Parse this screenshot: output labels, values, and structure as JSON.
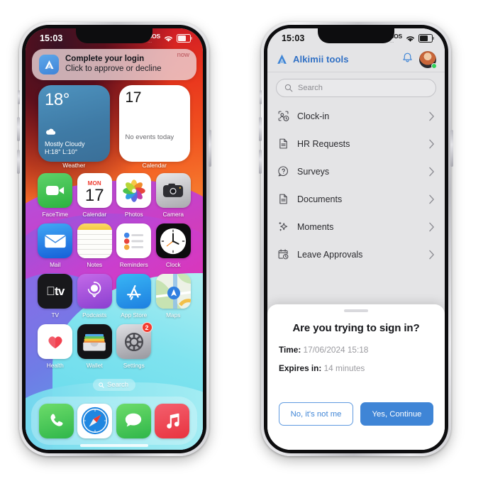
{
  "left_phone": {
    "status_bar": {
      "time": "15:03",
      "sos": "SOS",
      "sos_sub": "....",
      "wifi_icon": "wifi-icon",
      "battery_icon": "battery-icon"
    },
    "notification": {
      "app_icon": "alkimii-logo-icon",
      "title": "Complete your login",
      "subtitle": "Click to approve or decline",
      "time": "now"
    },
    "widgets": [
      {
        "type": "weather",
        "label": "Weather",
        "temperature": "18°",
        "condition": "Mostly Cloudy",
        "high_low": "H:18° L:10°",
        "icon": "cloud-icon"
      },
      {
        "type": "calendar",
        "label": "Calendar",
        "day_number": "17",
        "events_text": "No events today"
      }
    ],
    "apps": [
      {
        "label": "FaceTime",
        "icon": "facetime-icon"
      },
      {
        "label": "Calendar",
        "icon": "calendar-icon",
        "weekday": "MON",
        "day": "17"
      },
      {
        "label": "Photos",
        "icon": "photos-icon"
      },
      {
        "label": "Camera",
        "icon": "camera-icon"
      },
      {
        "label": "Mail",
        "icon": "mail-icon"
      },
      {
        "label": "Notes",
        "icon": "notes-icon"
      },
      {
        "label": "Reminders",
        "icon": "reminders-icon"
      },
      {
        "label": "Clock",
        "icon": "clock-icon"
      },
      {
        "label": "TV",
        "icon": "apple-tv-icon"
      },
      {
        "label": "Podcasts",
        "icon": "podcasts-icon"
      },
      {
        "label": "App Store",
        "icon": "app-store-icon"
      },
      {
        "label": "Maps",
        "icon": "maps-icon"
      },
      {
        "label": "Health",
        "icon": "health-icon"
      },
      {
        "label": "Wallet",
        "icon": "wallet-icon"
      },
      {
        "label": "Settings",
        "icon": "settings-icon",
        "badge": "2"
      }
    ],
    "search_pill": {
      "label": "Search",
      "icon": "search-icon"
    },
    "dock": [
      {
        "label": "Phone",
        "icon": "phone-icon"
      },
      {
        "label": "Safari",
        "icon": "safari-icon"
      },
      {
        "label": "Messages",
        "icon": "messages-icon"
      },
      {
        "label": "Music",
        "icon": "music-icon"
      }
    ]
  },
  "right_phone": {
    "status_bar": {
      "time": "15:03",
      "sos": "SOS",
      "sos_sub": "....",
      "wifi_icon": "wifi-icon",
      "battery_icon": "battery-icon"
    },
    "header": {
      "brand": "Alkimii tools",
      "logo_icon": "alkimii-logo-icon",
      "bell_icon": "bell-icon",
      "avatar": "user-avatar"
    },
    "search": {
      "placeholder": "Search",
      "value": "",
      "icon": "search-icon"
    },
    "menu_items": [
      {
        "label": "Clock-in",
        "icon": "clock-in-icon"
      },
      {
        "label": "HR Requests",
        "icon": "document-icon"
      },
      {
        "label": "Surveys",
        "icon": "survey-question-icon"
      },
      {
        "label": "Documents",
        "icon": "document-icon"
      },
      {
        "label": "Moments",
        "icon": "sparkles-icon"
      },
      {
        "label": "Leave Approvals",
        "icon": "calendar-clock-icon"
      }
    ],
    "sheet": {
      "title": "Are you trying to sign in?",
      "time_label": "Time:",
      "time_value": "17/06/2024 15:18",
      "expires_label": "Expires in:",
      "expires_value": "14 minutes",
      "decline_button": "No, it's not me",
      "confirm_button": "Yes, Continue"
    }
  },
  "colors": {
    "brand_blue": "#3f85d6",
    "brand_blue_text": "#2f6fc4",
    "online_green": "#31d158",
    "badge_red": "#f23b2f",
    "app_bg": "#e4e4e6",
    "sheet_bg": "#ffffff"
  }
}
